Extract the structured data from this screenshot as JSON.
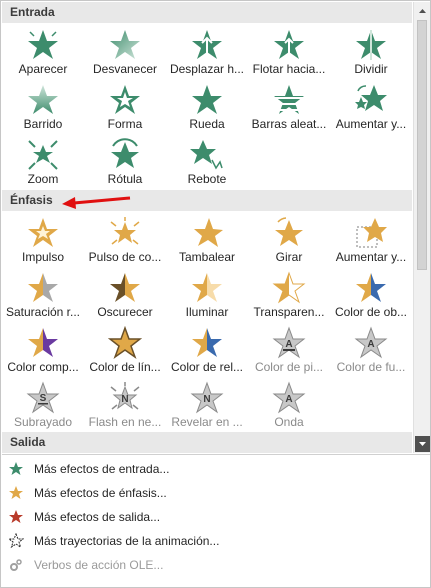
{
  "entrada": {
    "header": "Entrada",
    "items": [
      "Aparecer",
      "Desvanecer",
      "Desplazar h...",
      "Flotar hacia...",
      "Dividir",
      "Barrido",
      "Forma",
      "Rueda",
      "Barras aleat...",
      "Aumentar y...",
      "Zoom",
      "Rótula",
      "Rebote"
    ]
  },
  "enfasis": {
    "header": "Énfasis",
    "items": [
      "Impulso",
      "Pulso de co...",
      "Tambalear",
      "Girar",
      "Aumentar y...",
      "Saturación r...",
      "Oscurecer",
      "Iluminar",
      "Transparen...",
      "Color de ob...",
      "Color comp...",
      "Color de lín...",
      "Color de rel...",
      "Color de pi...",
      "Color de fu...",
      "Subrayado",
      "Flash en ne...",
      "Revelar en ...",
      "Onda"
    ],
    "letters": {
      "color_de_pi": "A",
      "color_de_fu": "A",
      "subrayado": "S",
      "flash": "N",
      "revelar": "N",
      "onda": "A"
    }
  },
  "salida": {
    "header": "Salida"
  },
  "menu": {
    "mas_entrada": "Más efectos de entrada...",
    "mas_enfasis": "Más efectos de énfasis...",
    "mas_salida": "Más efectos de salida...",
    "mas_trayectorias": "Más trayectorias de la animación...",
    "verbos_ole": "Verbos de acción OLE..."
  },
  "colors": {
    "entrada": "#3d8c6c",
    "enfasis": "#e0a848",
    "salida": "#b83a2a",
    "arrow": "#e01010"
  }
}
